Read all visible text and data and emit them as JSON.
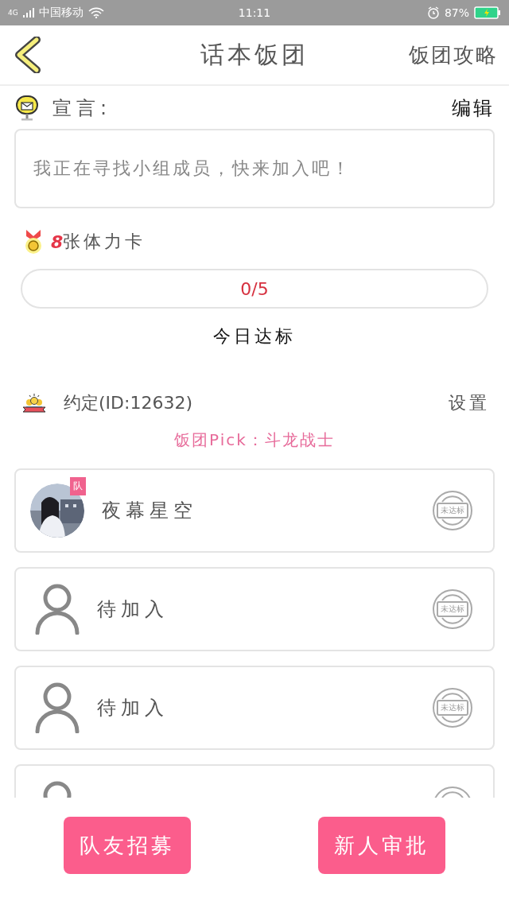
{
  "status_bar": {
    "network": "4G",
    "carrier": "中国移动",
    "time": "11:11",
    "battery_text": "87%"
  },
  "header": {
    "title": "话本饭团",
    "action": "饭团攻略"
  },
  "declaration": {
    "label": "宣言:",
    "edit": "编辑",
    "text": "我正在寻找小组成员，快来加入吧！"
  },
  "cards": {
    "count": "8",
    "label": "张体力卡"
  },
  "progress": {
    "reading": "0/5",
    "caption": "今日达标"
  },
  "group": {
    "name": "约定(ID:12632)",
    "settings": "设置",
    "pick": "饭团Pick：斗龙战士"
  },
  "members": [
    {
      "kind": "member",
      "name": "夜幕星空",
      "badge": "队",
      "status": "未达标"
    },
    {
      "kind": "vacant",
      "name": "待加入",
      "status": "未达标"
    },
    {
      "kind": "vacant",
      "name": "待加入",
      "status": "未达标"
    },
    {
      "kind": "vacant"
    }
  ],
  "buttons": [
    "队友招募",
    "新人审批"
  ]
}
